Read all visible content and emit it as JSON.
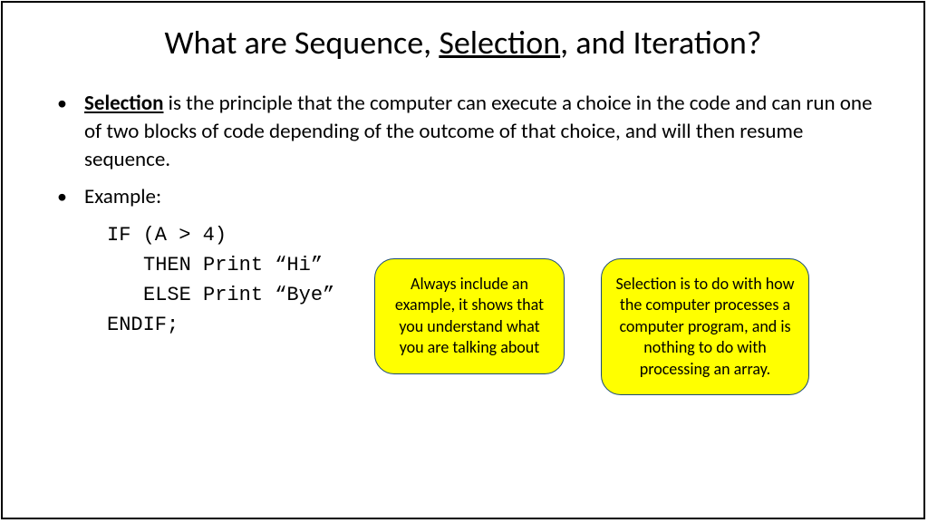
{
  "title": {
    "pre": "What are Sequence, ",
    "underlined": "Selection",
    "post": ", and Iteration?"
  },
  "bullets": {
    "definition": {
      "term": "Selection",
      "rest": " is the principle that the computer can execute a choice in the code and can run one of two blocks of code depending of the outcome of that choice, and will then resume sequence."
    },
    "example_label": "Example:"
  },
  "code": {
    "line1": "IF (A > 4)",
    "line2": "THEN Print “Hi”",
    "line3": "ELSE Print “Bye”",
    "line4": "ENDIF;"
  },
  "callout1": "Always include an example, it shows that you understand what you are talking about",
  "callout2": "Selection is to do with how the computer processes a computer program, and is nothing to do with processing an array."
}
